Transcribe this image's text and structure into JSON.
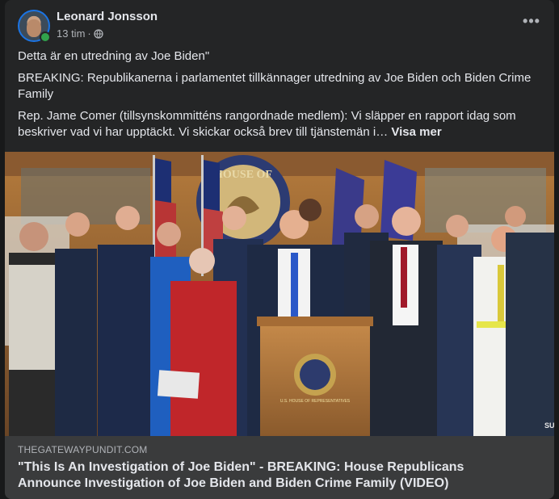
{
  "post": {
    "author": "Leonard Jonsson",
    "time": "13 tim",
    "separator": "·",
    "more_label": "•••",
    "paragraphs": [
      "Detta är en utredning av Joe Biden\"",
      "BREAKING: Republikanerna i parlamentet tillkännager utredning av Joe Biden och Biden Crime Family",
      "Rep. Jame Comer (tillsynskommitténs rangordnade medlem): Vi släpper en rapport idag som beskriver vad vi har upptäckt. Vi skickar också brev till tjänstemän i…"
    ],
    "see_more": "Visa mer"
  },
  "media": {
    "seal_text": "HOUSE OF",
    "podium_seal_text": "U.S. HOUSE OF REPRESENTATIVES",
    "corner_text": "SU"
  },
  "link": {
    "domain": "THEGATEWAYPUNDIT.COM",
    "title": "\"This Is An Investigation of Joe Biden\" - BREAKING: House Republicans Announce Investigation of Joe Biden and Biden Crime Family (VIDEO)"
  },
  "colors": {
    "background": "#18191a",
    "card": "#242526",
    "link_preview": "#3a3b3c",
    "online": "#31a24c",
    "accent": "#1b74e4"
  }
}
